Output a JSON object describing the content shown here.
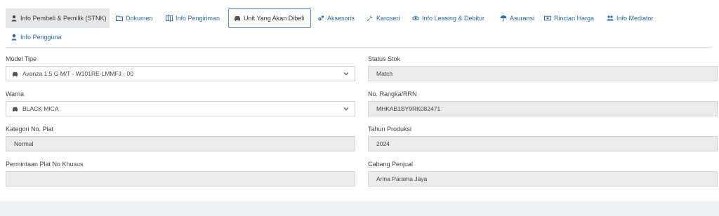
{
  "tabs": [
    {
      "label": "Info Pembeli & Pemilik (STNK)",
      "icon": "user-icon"
    },
    {
      "label": "Dokumen",
      "icon": "folder-icon"
    },
    {
      "label": "Info Pengiriman",
      "icon": "map-icon"
    },
    {
      "label": "Unit Yang Akan Dibeli",
      "icon": "car-icon"
    },
    {
      "label": "Aksesoris",
      "icon": "gears-icon"
    },
    {
      "label": "Karoseri",
      "icon": "wrench-icon"
    },
    {
      "label": "Info Leasing & Debitur",
      "icon": "eye-icon"
    },
    {
      "label": "Asuransi",
      "icon": "umbrella-icon"
    },
    {
      "label": "Rincian Harga",
      "icon": "money-icon"
    },
    {
      "label": "Info Mediator",
      "icon": "users-icon"
    },
    {
      "label": "Info Pengguna",
      "icon": "user-icon"
    }
  ],
  "form": {
    "model_tipe": {
      "label": "Model Tipe",
      "value": "Avanza 1.5 G M/T - W101RE-LMMFJ - 00"
    },
    "status_stok": {
      "label": "Status Stok",
      "value": "Match"
    },
    "warna": {
      "label": "Warna",
      "value": "BLACK MICA"
    },
    "no_rangka": {
      "label": "No. Rangka/RRN",
      "value": "MHKAB1BY9RK082471"
    },
    "kategori_plat": {
      "label": "Kategori No. Plat",
      "value": "Normal"
    },
    "tahun_produksi": {
      "label": "Tahun Produksi",
      "value": "2024"
    },
    "plat_khusus": {
      "label": "Permintaan Plat No Khusus",
      "value": ""
    },
    "cabang_penjual": {
      "label": "Cabang Penjual",
      "value": "Arina Parama Jaya"
    }
  },
  "colors": {
    "link": "#2f6aa8",
    "active_border": "#5a8fc9",
    "readonly_bg": "#ebebeb"
  }
}
